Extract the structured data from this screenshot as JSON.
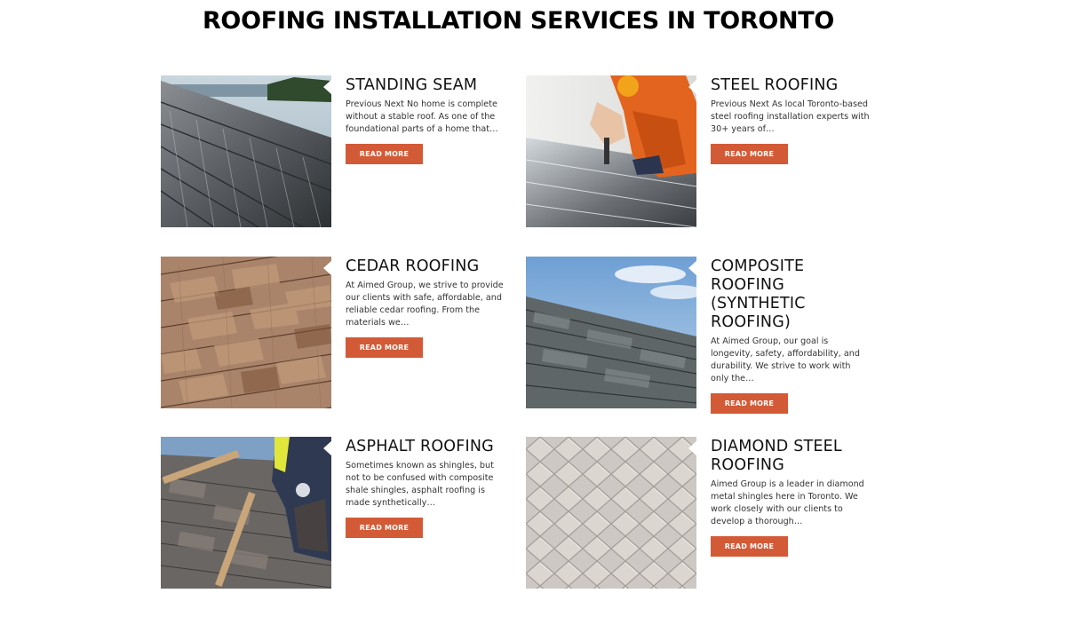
{
  "heading": "ROOFING INSTALLATION SERVICES IN TORONTO",
  "read_more_label": "READ MORE",
  "accent_color": "#d35a36",
  "services": [
    {
      "title": "STANDING SEAM",
      "excerpt": "Previous Next     No home is complete without a stable roof. As one of the foundational parts of a home that…",
      "image": "standing-seam-metal-roof-lake-photo"
    },
    {
      "title": "STEEL ROOFING",
      "excerpt": "Previous Next     As local Toronto-based steel roofing installation experts with 30+ years of…",
      "image": "worker-drilling-steel-roof-photo"
    },
    {
      "title": "CEDAR ROOFING",
      "excerpt": "   At Aimed Group, we strive to provide our clients with safe, affordable, and reliable cedar roofing. From the materials we…",
      "image": "cedar-shake-roof-photo"
    },
    {
      "title": "COMPOSITE ROOFING (SYNTHETIC ROOFING)",
      "excerpt": "   At Aimed Group, our goal is longevity, safety, affordability, and durability. We strive to work with only the…",
      "image": "slate-roof-sky-photo"
    },
    {
      "title": "ASPHALT ROOFING",
      "excerpt": "   Sometimes known as shingles, but not to be confused with composite shale shingles, asphalt roofing is made synthetically…",
      "image": "worker-installing-asphalt-shingles-photo"
    },
    {
      "title": "DIAMOND STEEL ROOFING",
      "excerpt": "   Aimed Group is a leader in diamond metal shingles here in Toronto. We work closely with our clients to develop a thorough…",
      "image": "diamond-metal-shingles-photo"
    }
  ]
}
